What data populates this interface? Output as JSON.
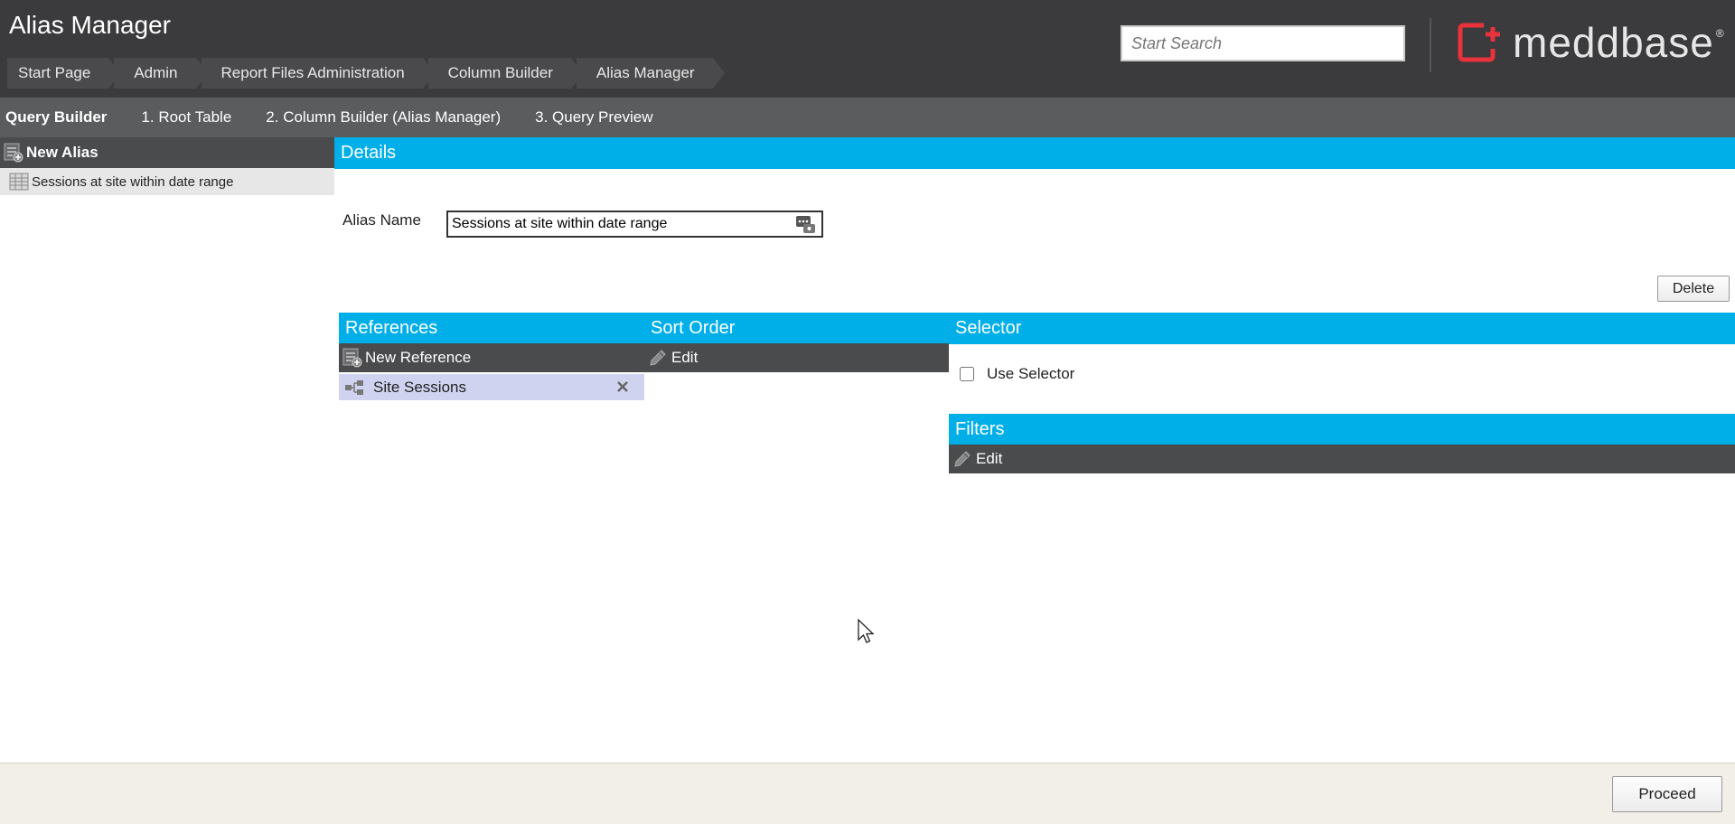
{
  "header": {
    "title": "Alias Manager",
    "breadcrumb": [
      "Start Page",
      "Admin",
      "Report Files Administration",
      "Column Builder",
      "Alias Manager"
    ],
    "search_placeholder": "Start Search",
    "logo_text": "meddbase",
    "logo_mark_symbol": "®",
    "brand_color": "#e8323c",
    "accent_color": "#00aee8"
  },
  "navbar": {
    "items": [
      "Query Builder",
      "1. Root Table",
      "2. Column Builder (Alias Manager)",
      "3. Query Preview"
    ]
  },
  "sidebar": {
    "new_alias_label": "New Alias",
    "aliases": [
      "Sessions at site within date range"
    ]
  },
  "details": {
    "header": "Details",
    "alias_name_label": "Alias Name",
    "alias_name_value": "Sessions at site within date range",
    "delete_label": "Delete"
  },
  "references": {
    "header": "References",
    "new_reference_label": "New Reference",
    "items": [
      {
        "label": "Site Sessions"
      }
    ]
  },
  "sort_order": {
    "header": "Sort Order",
    "edit_label": "Edit"
  },
  "selector": {
    "header": "Selector",
    "use_selector_label": "Use Selector",
    "checked": false
  },
  "filters": {
    "header": "Filters",
    "edit_label": "Edit"
  },
  "footer": {
    "proceed_label": "Proceed"
  }
}
